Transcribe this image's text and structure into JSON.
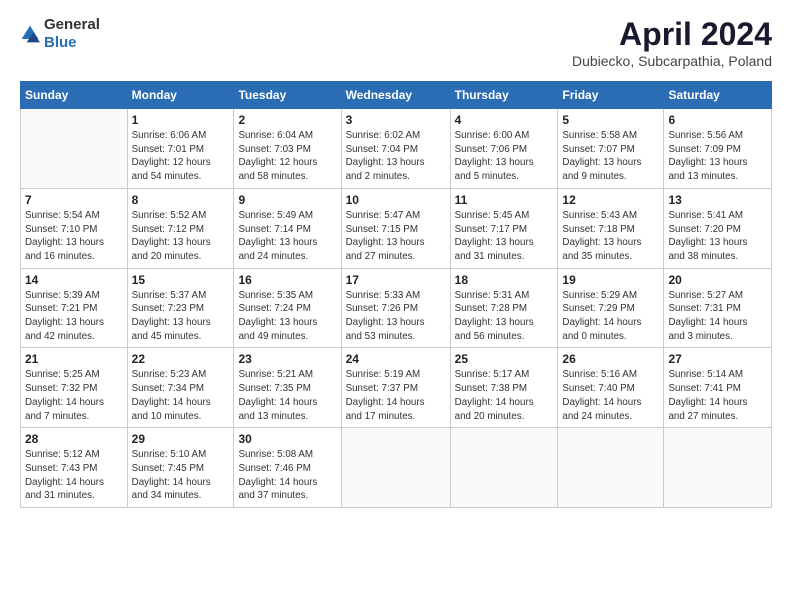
{
  "logo": {
    "general": "General",
    "blue": "Blue"
  },
  "header": {
    "title": "April 2024",
    "subtitle": "Dubiecko, Subcarpathia, Poland"
  },
  "weekdays": [
    "Sunday",
    "Monday",
    "Tuesday",
    "Wednesday",
    "Thursday",
    "Friday",
    "Saturday"
  ],
  "weeks": [
    [
      {
        "day": "",
        "info": ""
      },
      {
        "day": "1",
        "info": "Sunrise: 6:06 AM\nSunset: 7:01 PM\nDaylight: 12 hours\nand 54 minutes."
      },
      {
        "day": "2",
        "info": "Sunrise: 6:04 AM\nSunset: 7:03 PM\nDaylight: 12 hours\nand 58 minutes."
      },
      {
        "day": "3",
        "info": "Sunrise: 6:02 AM\nSunset: 7:04 PM\nDaylight: 13 hours\nand 2 minutes."
      },
      {
        "day": "4",
        "info": "Sunrise: 6:00 AM\nSunset: 7:06 PM\nDaylight: 13 hours\nand 5 minutes."
      },
      {
        "day": "5",
        "info": "Sunrise: 5:58 AM\nSunset: 7:07 PM\nDaylight: 13 hours\nand 9 minutes."
      },
      {
        "day": "6",
        "info": "Sunrise: 5:56 AM\nSunset: 7:09 PM\nDaylight: 13 hours\nand 13 minutes."
      }
    ],
    [
      {
        "day": "7",
        "info": "Sunrise: 5:54 AM\nSunset: 7:10 PM\nDaylight: 13 hours\nand 16 minutes."
      },
      {
        "day": "8",
        "info": "Sunrise: 5:52 AM\nSunset: 7:12 PM\nDaylight: 13 hours\nand 20 minutes."
      },
      {
        "day": "9",
        "info": "Sunrise: 5:49 AM\nSunset: 7:14 PM\nDaylight: 13 hours\nand 24 minutes."
      },
      {
        "day": "10",
        "info": "Sunrise: 5:47 AM\nSunset: 7:15 PM\nDaylight: 13 hours\nand 27 minutes."
      },
      {
        "day": "11",
        "info": "Sunrise: 5:45 AM\nSunset: 7:17 PM\nDaylight: 13 hours\nand 31 minutes."
      },
      {
        "day": "12",
        "info": "Sunrise: 5:43 AM\nSunset: 7:18 PM\nDaylight: 13 hours\nand 35 minutes."
      },
      {
        "day": "13",
        "info": "Sunrise: 5:41 AM\nSunset: 7:20 PM\nDaylight: 13 hours\nand 38 minutes."
      }
    ],
    [
      {
        "day": "14",
        "info": "Sunrise: 5:39 AM\nSunset: 7:21 PM\nDaylight: 13 hours\nand 42 minutes."
      },
      {
        "day": "15",
        "info": "Sunrise: 5:37 AM\nSunset: 7:23 PM\nDaylight: 13 hours\nand 45 minutes."
      },
      {
        "day": "16",
        "info": "Sunrise: 5:35 AM\nSunset: 7:24 PM\nDaylight: 13 hours\nand 49 minutes."
      },
      {
        "day": "17",
        "info": "Sunrise: 5:33 AM\nSunset: 7:26 PM\nDaylight: 13 hours\nand 53 minutes."
      },
      {
        "day": "18",
        "info": "Sunrise: 5:31 AM\nSunset: 7:28 PM\nDaylight: 13 hours\nand 56 minutes."
      },
      {
        "day": "19",
        "info": "Sunrise: 5:29 AM\nSunset: 7:29 PM\nDaylight: 14 hours\nand 0 minutes."
      },
      {
        "day": "20",
        "info": "Sunrise: 5:27 AM\nSunset: 7:31 PM\nDaylight: 14 hours\nand 3 minutes."
      }
    ],
    [
      {
        "day": "21",
        "info": "Sunrise: 5:25 AM\nSunset: 7:32 PM\nDaylight: 14 hours\nand 7 minutes."
      },
      {
        "day": "22",
        "info": "Sunrise: 5:23 AM\nSunset: 7:34 PM\nDaylight: 14 hours\nand 10 minutes."
      },
      {
        "day": "23",
        "info": "Sunrise: 5:21 AM\nSunset: 7:35 PM\nDaylight: 14 hours\nand 13 minutes."
      },
      {
        "day": "24",
        "info": "Sunrise: 5:19 AM\nSunset: 7:37 PM\nDaylight: 14 hours\nand 17 minutes."
      },
      {
        "day": "25",
        "info": "Sunrise: 5:17 AM\nSunset: 7:38 PM\nDaylight: 14 hours\nand 20 minutes."
      },
      {
        "day": "26",
        "info": "Sunrise: 5:16 AM\nSunset: 7:40 PM\nDaylight: 14 hours\nand 24 minutes."
      },
      {
        "day": "27",
        "info": "Sunrise: 5:14 AM\nSunset: 7:41 PM\nDaylight: 14 hours\nand 27 minutes."
      }
    ],
    [
      {
        "day": "28",
        "info": "Sunrise: 5:12 AM\nSunset: 7:43 PM\nDaylight: 14 hours\nand 31 minutes."
      },
      {
        "day": "29",
        "info": "Sunrise: 5:10 AM\nSunset: 7:45 PM\nDaylight: 14 hours\nand 34 minutes."
      },
      {
        "day": "30",
        "info": "Sunrise: 5:08 AM\nSunset: 7:46 PM\nDaylight: 14 hours\nand 37 minutes."
      },
      {
        "day": "",
        "info": ""
      },
      {
        "day": "",
        "info": ""
      },
      {
        "day": "",
        "info": ""
      },
      {
        "day": "",
        "info": ""
      }
    ]
  ]
}
